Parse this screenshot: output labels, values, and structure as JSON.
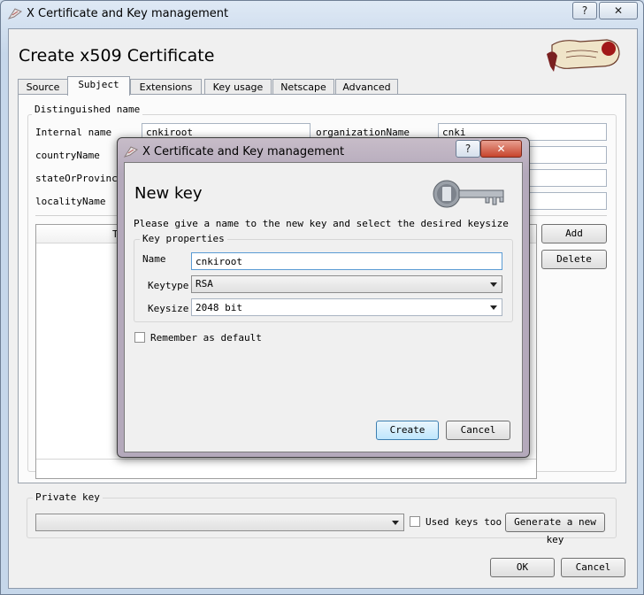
{
  "window": {
    "title": "X Certificate and Key management",
    "help_glyph": "?",
    "close_glyph": "✕",
    "header_title": "Create x509 Certificate",
    "logo_icon": "seal-logo-icon"
  },
  "tabs": [
    "Source",
    "Subject",
    "Extensions",
    "Key usage",
    "Netscape",
    "Advanced"
  ],
  "active_tab": "Subject",
  "subject": {
    "group_label": "Distinguished name",
    "internal_name_label": "Internal name",
    "internal_name_value": "cnkiroot",
    "org_label": "organizationName",
    "org_value": "cnki",
    "country_label": "countryName",
    "state_label": "stateOrProvinceName",
    "locality_label": "localityName",
    "table_header_fragment": "T",
    "add_label": "Add",
    "delete_label": "Delete"
  },
  "private_key": {
    "group_label": "Private key",
    "used_keys_label": "Used keys too",
    "generate_label": "Generate a new key"
  },
  "footer": {
    "ok_label": "OK",
    "cancel_label": "Cancel"
  },
  "dialog": {
    "title": "X Certificate and Key management",
    "heading": "New key",
    "instruction": "Please give a name to the new key and select the desired keysize",
    "group_label": "Key properties",
    "name_label": "Name",
    "name_value": "cnkiroot",
    "keytype_label": "Keytype",
    "keytype_value": "RSA",
    "keysize_label": "Keysize",
    "keysize_value": "2048 bit",
    "remember_label": "Remember as default",
    "create_label": "Create",
    "cancel_label": "Cancel",
    "key_icon": "key-icon"
  },
  "colors": {
    "title_bar": "#c6d7ea",
    "dialog_frame": "#b4a9bb",
    "default_button": "#bee6fd"
  }
}
